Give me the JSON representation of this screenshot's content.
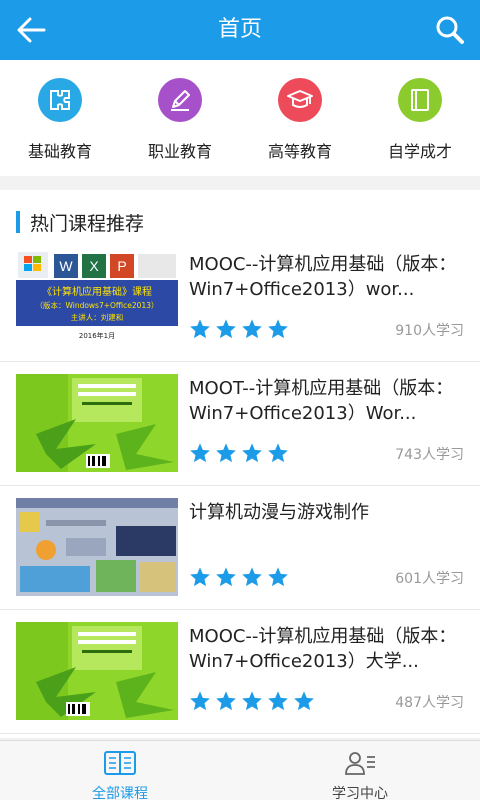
{
  "header": {
    "title": "首页",
    "back_icon": "arrow-left-icon",
    "search_icon": "search-icon"
  },
  "categories": [
    {
      "label": "基础教育",
      "icon": "puzzle-icon",
      "color": "#29a8e6"
    },
    {
      "label": "职业教育",
      "icon": "pencil-icon",
      "color": "#a651c9"
    },
    {
      "label": "高等教育",
      "icon": "graduation-cap-icon",
      "color": "#ee4b5a"
    },
    {
      "label": "自学成才",
      "icon": "book-icon",
      "color": "#8ccb2e"
    }
  ],
  "section": {
    "title": "热门课程推荐"
  },
  "courses": [
    {
      "name": "MOOC--计算机应用基础（版本：Win7+Office2013）wor...",
      "stars": 4,
      "count": "910人学习"
    },
    {
      "name": "MOOT--计算机应用基础（版本：Win7+Office2013）Wor...",
      "stars": 4,
      "count": "743人学习"
    },
    {
      "name": "计算机动漫与游戏制作",
      "stars": 4,
      "count": "601人学习"
    },
    {
      "name": "MOOC--计算机应用基础（版本：Win7+Office2013）大学...",
      "stars": 5,
      "count": "487人学习"
    }
  ],
  "thumb1": {
    "title": "《计算机应用基础》课程",
    "subtitle": "（版本：Windows7+Office2013）",
    "lecturer": "主讲人：刘建和",
    "date": "2016年1月"
  },
  "tabbar": [
    {
      "label": "全部课程",
      "icon": "course-list-icon",
      "active": true
    },
    {
      "label": "学习中心",
      "icon": "user-profile-icon",
      "active": false
    }
  ],
  "colors": {
    "accent": "#1b9be8",
    "star": "#1b9be8",
    "muted": "#999999"
  }
}
